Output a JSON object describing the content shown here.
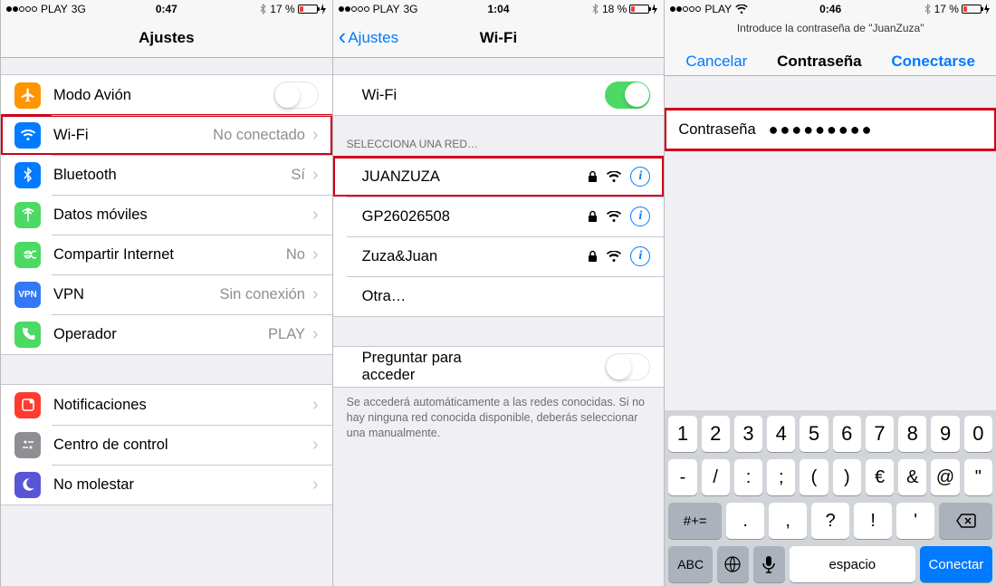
{
  "pane1": {
    "status": {
      "carrier": "PLAY",
      "net": "3G",
      "time": "0:47",
      "battery": "17 %"
    },
    "title": "Ajustes",
    "rows": {
      "airplane": "Modo Avión",
      "wifi": "Wi-Fi",
      "wifi_val": "No conectado",
      "bluetooth": "Bluetooth",
      "bluetooth_val": "Sí",
      "cellular": "Datos móviles",
      "hotspot": "Compartir Internet",
      "hotspot_val": "No",
      "vpn": "VPN",
      "vpn_val": "Sin conexión",
      "carrier": "Operador",
      "carrier_val": "PLAY",
      "notifications": "Notificaciones",
      "control": "Centro de control",
      "dnd": "No molestar"
    }
  },
  "pane2": {
    "status": {
      "carrier": "PLAY",
      "net": "3G",
      "time": "1:04",
      "battery": "18 %"
    },
    "back": "Ajustes",
    "title": "Wi-Fi",
    "wifi_label": "Wi-Fi",
    "select_header": "SELECCIONA UNA RED…",
    "networks": {
      "n0": "JUANZUZA",
      "n1": "GP26026508",
      "n2": "Zuza&Juan",
      "other": "Otra…"
    },
    "ask_label": "Preguntar para acceder",
    "footer": "Se accederá automáticamente a las redes conocidas. Si no hay ninguna red conocida disponible, deberás seleccionar una manualmente."
  },
  "pane3": {
    "status": {
      "carrier": "PLAY",
      "net": "wifi",
      "time": "0:46",
      "battery": "17 %"
    },
    "subtitle": "Introduce la contraseña de \"JuanZuza\"",
    "cancel": "Cancelar",
    "title": "Contraseña",
    "connect": "Conectarse",
    "pw_label": "Contraseña",
    "pw_value": "●●●●●●●●●",
    "keyboard": {
      "r1": [
        "1",
        "2",
        "3",
        "4",
        "5",
        "6",
        "7",
        "8",
        "9",
        "0"
      ],
      "r2": [
        "-",
        "/",
        ":",
        ";",
        "(",
        ")",
        "€",
        "&",
        "@",
        "\""
      ],
      "r3_shift": "#+=",
      "r3": [
        ".",
        ",",
        "?",
        "!",
        "'"
      ],
      "r4_abc": "ABC",
      "r4_space": "espacio",
      "r4_conn": "Conectar"
    }
  }
}
